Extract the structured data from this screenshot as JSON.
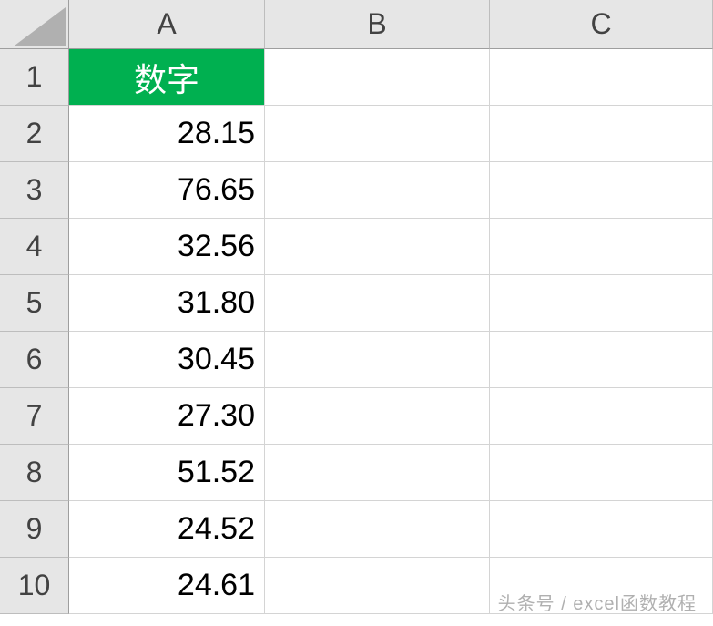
{
  "columns": [
    "A",
    "B",
    "C"
  ],
  "rowNumbers": [
    "1",
    "2",
    "3",
    "4",
    "5",
    "6",
    "7",
    "8",
    "9",
    "10"
  ],
  "headerCell": "数字",
  "values": [
    "28.15",
    "76.65",
    "32.56",
    "31.80",
    "30.45",
    "27.30",
    "51.52",
    "24.52",
    "24.61"
  ],
  "watermark": "头条号 / excel函数教程",
  "chart_data": {
    "type": "table",
    "title": "数字",
    "columns": [
      "数字"
    ],
    "rows": [
      [
        28.15
      ],
      [
        76.65
      ],
      [
        32.56
      ],
      [
        31.8
      ],
      [
        30.45
      ],
      [
        27.3
      ],
      [
        51.52
      ],
      [
        24.52
      ],
      [
        24.61
      ]
    ]
  }
}
